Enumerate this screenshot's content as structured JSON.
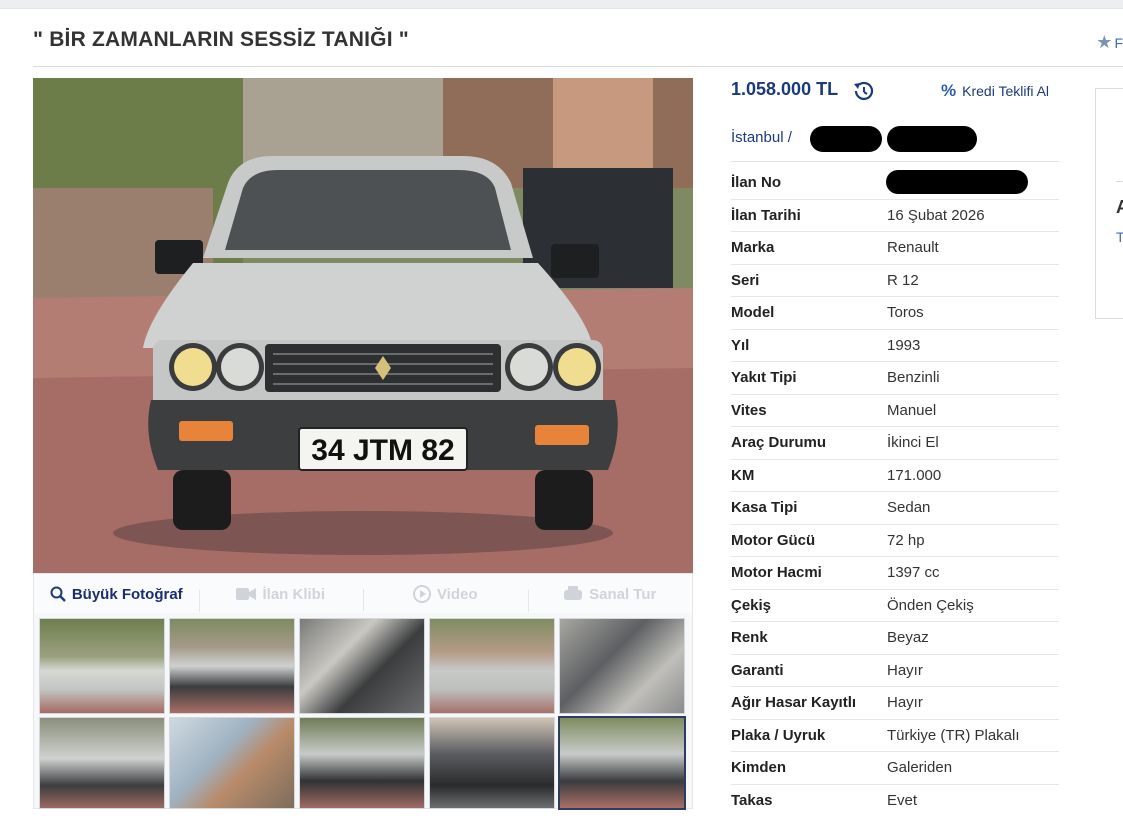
{
  "listing": {
    "title": "\" BİR ZAMANLARIN SESSİZ TANIĞI \"",
    "favorite_label": "F",
    "price": "1.058.000 TL",
    "credit_label": "Kredi Teklifi Al",
    "city": "İstanbul",
    "location_sep": "/"
  },
  "media": {
    "big_photo": "Büyük Fotoğraf",
    "clip": "İlan Klibi",
    "video": "Video",
    "tour": "Sanal Tur"
  },
  "plate": "34 JTM 82",
  "specs": [
    {
      "label": "İlan No",
      "value": ""
    },
    {
      "label": "İlan Tarihi",
      "value": "16 Şubat 2026"
    },
    {
      "label": "Marka",
      "value": "Renault"
    },
    {
      "label": "Seri",
      "value": "R 12"
    },
    {
      "label": "Model",
      "value": "Toros"
    },
    {
      "label": "Yıl",
      "value": "1993"
    },
    {
      "label": "Yakıt Tipi",
      "value": "Benzinli"
    },
    {
      "label": "Vites",
      "value": "Manuel"
    },
    {
      "label": "Araç Durumu",
      "value": "İkinci El"
    },
    {
      "label": "KM",
      "value": "171.000"
    },
    {
      "label": "Kasa Tipi",
      "value": "Sedan"
    },
    {
      "label": "Motor Gücü",
      "value": "72 hp"
    },
    {
      "label": "Motor Hacmi",
      "value": "1397 cc"
    },
    {
      "label": "Çekiş",
      "value": "Önden Çekiş"
    },
    {
      "label": "Renk",
      "value": "Beyaz"
    },
    {
      "label": "Garanti",
      "value": "Hayır"
    },
    {
      "label": "Ağır Hasar Kayıtlı",
      "value": "Hayır"
    },
    {
      "label": "Plaka / Uyruk",
      "value": "Türkiye (TR) Plakalı"
    },
    {
      "label": "Kimden",
      "value": "Galeriden"
    },
    {
      "label": "Takas",
      "value": "Evet"
    }
  ],
  "side_card": {
    "letter": "A",
    "link": "T"
  },
  "colors": {
    "accent": "#1b3a7a",
    "link": "#3b6db2",
    "car_body": "#c9ccc9",
    "plate_bg": "#f4f4f0"
  }
}
